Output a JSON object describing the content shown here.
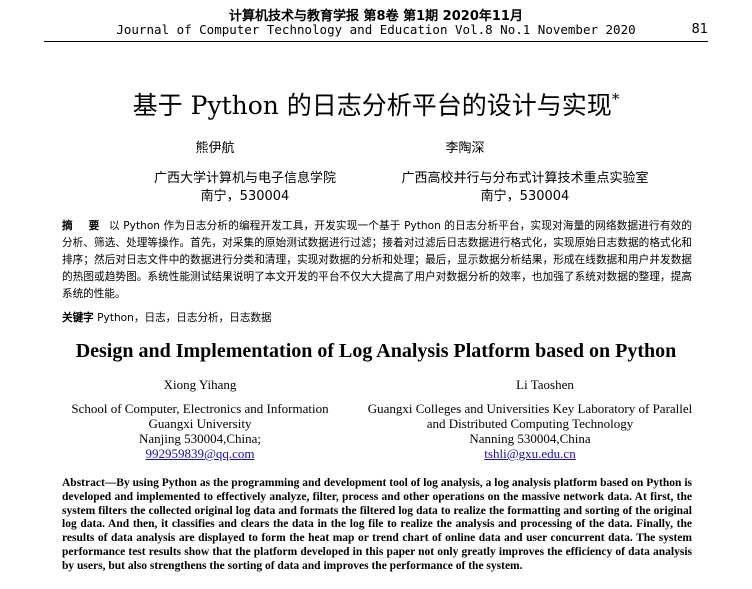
{
  "header": {
    "journal_cn": "计算机技术与教育学报 第8卷 第1期 2020年11月",
    "journal_en": "Journal of Computer Technology and Education Vol.8 No.1 November 2020",
    "page_number": "81"
  },
  "title_cn": "基于 Python 的日志分析平台的设计与实现",
  "title_mark": "*",
  "authors_cn": [
    {
      "name": "熊伊航",
      "affiliation": "广西大学计算机与电子信息学院",
      "address": "南宁，530004"
    },
    {
      "name": "李陶深",
      "affiliation": "广西高校并行与分布式计算技术重点实验室",
      "address": "南宁，530004"
    }
  ],
  "abstract_cn": {
    "label": "摘 要",
    "text": "以 Python 作为日志分析的编程开发工具，开发实现一个基于 Python 的日志分析平台，实现对海量的网络数据进行有效的分析、筛选、处理等操作。首先，对采集的原始测试数据进行过滤；接着对过滤后日志数据进行格式化，实现原始日志数据的格式化和排序；然后对日志文件中的数据进行分类和清理，实现对数据的分析和处理；最后，显示数据分析结果，形成在线数据和用户并发数据的热图或趋势图。系统性能测试结果说明了本文开发的平台不仅大大提高了用户对数据分析的效率，也加强了系统对数据的整理，提高系统的性能。"
  },
  "keywords_cn": {
    "label": "关键字",
    "text": "Python，日志，日志分析，日志数据"
  },
  "title_en": "Design and Implementation of Log Analysis Platform based on Python",
  "authors_en": [
    {
      "name": "Xiong   Yihang",
      "affil_line1": "School of Computer, Electronics and Information",
      "affil_line2": "Guangxi   University",
      "address": "Nanjing 530004,China;",
      "email": "992959839@qq.com"
    },
    {
      "name": "Li Taoshen",
      "affil_line1": "Guangxi Colleges and Universities Key Laboratory of Parallel",
      "affil_line2": "and Distributed Computing Technology",
      "address": "Nanning 530004,China",
      "email": "tshli@gxu.edu.cn"
    }
  ],
  "abstract_en": {
    "label": "Abstract—",
    "text": "By using Python as the programming and development tool of log analysis, a log analysis platform based on Python is developed and implemented to effectively analyze, filter, process and other operations on the massive network data. At first, the system filters the collected original log data and formats the filtered log data to realize the formatting and sorting of the original log data. And then, it classifies and clears the data in the log file to realize the analysis and processing of the data. Finally, the results of data analysis are displayed to form the heat map or trend chart of online data and user concurrent data. The system performance test results show that the platform developed in this paper not only greatly improves the efficiency of data analysis by users, but also strengthens the sorting of data and improves the performance of the system."
  },
  "colors": {
    "link": "#1a0dab"
  }
}
